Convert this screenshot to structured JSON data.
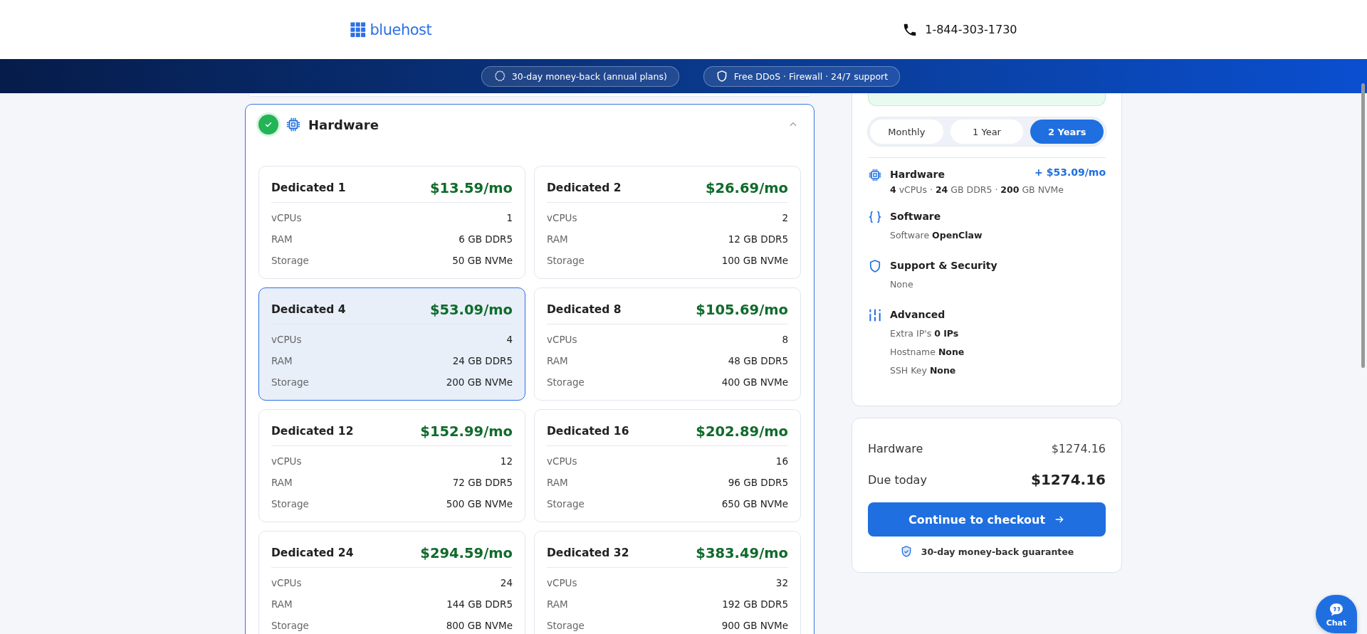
{
  "header": {
    "logo": "bluehost",
    "phone": "1-844-303-1730"
  },
  "banner": {
    "badges": [
      {
        "text": "30-day money-back (annual plans)"
      },
      {
        "text": "Free DDoS · Firewall · 24/7 support"
      }
    ]
  },
  "hardware_section": {
    "title": "Hardware",
    "completed": true,
    "expanded": true,
    "plans": [
      {
        "name": "Dedicated 1",
        "price": "$13.59/mo",
        "selected": false,
        "specs": [
          {
            "label": "vCPUs",
            "value": "1"
          },
          {
            "label": "RAM",
            "value": "6 GB DDR5"
          },
          {
            "label": "Storage",
            "value": "50 GB NVMe"
          }
        ]
      },
      {
        "name": "Dedicated 2",
        "price": "$26.69/mo",
        "selected": false,
        "specs": [
          {
            "label": "vCPUs",
            "value": "2"
          },
          {
            "label": "RAM",
            "value": "12 GB DDR5"
          },
          {
            "label": "Storage",
            "value": "100 GB NVMe"
          }
        ]
      },
      {
        "name": "Dedicated 4",
        "price": "$53.09/mo",
        "selected": true,
        "specs": [
          {
            "label": "vCPUs",
            "value": "4"
          },
          {
            "label": "RAM",
            "value": "24 GB DDR5"
          },
          {
            "label": "Storage",
            "value": "200 GB NVMe"
          }
        ]
      },
      {
        "name": "Dedicated 8",
        "price": "$105.69/mo",
        "selected": false,
        "specs": [
          {
            "label": "vCPUs",
            "value": "8"
          },
          {
            "label": "RAM",
            "value": "48 GB DDR5"
          },
          {
            "label": "Storage",
            "value": "400 GB NVMe"
          }
        ]
      },
      {
        "name": "Dedicated 12",
        "price": "$152.99/mo",
        "selected": false,
        "specs": [
          {
            "label": "vCPUs",
            "value": "12"
          },
          {
            "label": "RAM",
            "value": "72 GB DDR5"
          },
          {
            "label": "Storage",
            "value": "500 GB NVMe"
          }
        ]
      },
      {
        "name": "Dedicated 16",
        "price": "$202.89/mo",
        "selected": false,
        "specs": [
          {
            "label": "vCPUs",
            "value": "16"
          },
          {
            "label": "RAM",
            "value": "96 GB DDR5"
          },
          {
            "label": "Storage",
            "value": "650 GB NVMe"
          }
        ]
      },
      {
        "name": "Dedicated 24",
        "price": "$294.59/mo",
        "selected": false,
        "specs": [
          {
            "label": "vCPUs",
            "value": "24"
          },
          {
            "label": "RAM",
            "value": "144 GB DDR5"
          },
          {
            "label": "Storage",
            "value": "800 GB NVMe"
          }
        ]
      },
      {
        "name": "Dedicated 32",
        "price": "$383.49/mo",
        "selected": false,
        "specs": [
          {
            "label": "vCPUs",
            "value": "32"
          },
          {
            "label": "RAM",
            "value": "192 GB DDR5"
          },
          {
            "label": "Storage",
            "value": "900 GB NVMe"
          }
        ]
      }
    ]
  },
  "summary": {
    "billing_options": [
      {
        "label": "Monthly",
        "selected": false
      },
      {
        "label": "1 Year",
        "selected": false
      },
      {
        "label": "2 Years",
        "selected": true
      }
    ],
    "items": [
      {
        "kind": "hardware",
        "title": "Hardware",
        "price": "+ $53.09/mo",
        "lines": [
          "**4** vCPUs · **24** GB DDR5 · **200** GB NVMe"
        ]
      },
      {
        "kind": "software",
        "title": "Software",
        "lines": [
          "Software **OpenClaw**"
        ]
      },
      {
        "kind": "security",
        "title": "Support & Security",
        "lines": [
          "None"
        ]
      },
      {
        "kind": "advanced",
        "title": "Advanced",
        "lines": [
          "Extra IP's **0 IPs**",
          "Hostname **None**",
          "SSH Key **None**"
        ]
      }
    ]
  },
  "totals": {
    "rows": [
      {
        "kind": "subtotal",
        "label": "Hardware",
        "amount": "$1274.16"
      },
      {
        "kind": "total",
        "label": "Due today",
        "amount": "$1274.16"
      }
    ],
    "checkout_button": "Continue to checkout",
    "guarantee": "30-day money-back guarantee"
  },
  "chat": {
    "label": "Chat"
  }
}
